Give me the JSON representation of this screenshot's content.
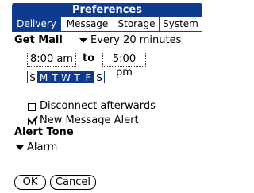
{
  "title": "Preferences",
  "tabs": [
    {
      "label": "Delivery",
      "active": true
    },
    {
      "label": "Message",
      "active": false
    },
    {
      "label": "Storage",
      "active": false
    },
    {
      "label": "System",
      "active": false
    }
  ],
  "get_mail": {
    "label": "Get Mail",
    "interval": "Every 20 minutes",
    "from_time": "8:00 am",
    "to_label": "to",
    "to_time": "5:00 pm",
    "days": [
      {
        "label": "S",
        "selected": false
      },
      {
        "label": "M",
        "selected": true
      },
      {
        "label": "T",
        "selected": true
      },
      {
        "label": "W",
        "selected": true
      },
      {
        "label": "T",
        "selected": true
      },
      {
        "label": "F",
        "selected": true
      },
      {
        "label": "S",
        "selected": false
      }
    ]
  },
  "options": {
    "disconnect": {
      "label": "Disconnect afterwards",
      "checked": false
    },
    "new_message_alert": {
      "label": "New Message Alert",
      "checked": true
    }
  },
  "alert_tone": {
    "label": "Alert Tone",
    "value": "Alarm"
  },
  "buttons": {
    "ok": "OK",
    "cancel": "Cancel"
  },
  "colors": {
    "accent": "#103a8e"
  }
}
